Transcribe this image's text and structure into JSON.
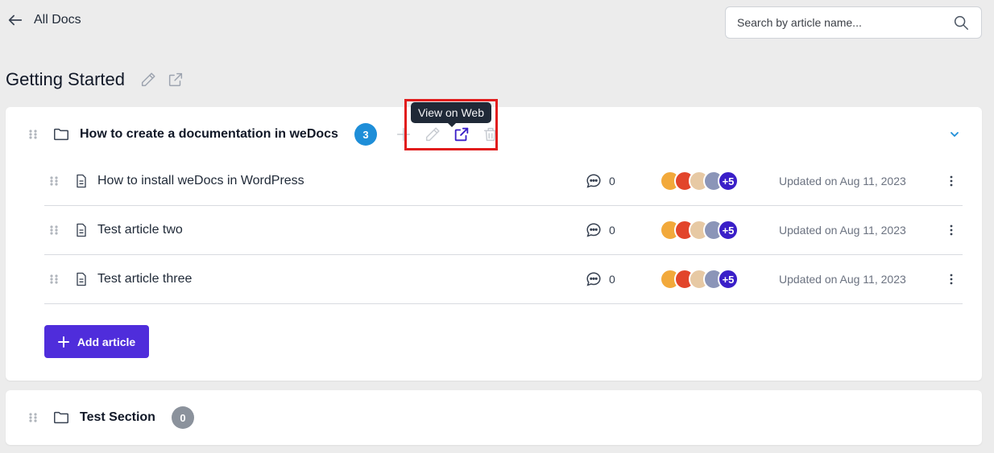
{
  "nav": {
    "back_label": "All Docs"
  },
  "search": {
    "placeholder": "Search by article name..."
  },
  "page": {
    "title": "Getting Started"
  },
  "colors": {
    "accent": "#4f2ddb",
    "badge_blue": "#1e8ed8",
    "badge_gray": "#8b929c",
    "highlight": "#e11d1d",
    "plus_avatar": "#3a1fc8"
  },
  "sections": [
    {
      "title": "How to create a documentation in weDocs",
      "count": "3",
      "tooltip": "View on Web",
      "articles": [
        {
          "title": "How to install weDocs in WordPress",
          "comments": "0",
          "avatar_more": "+5",
          "updated": "Updated on Aug 11, 2023"
        },
        {
          "title": "Test article two",
          "comments": "0",
          "avatar_more": "+5",
          "updated": "Updated on Aug 11, 2023"
        },
        {
          "title": "Test article three",
          "comments": "0",
          "avatar_more": "+5",
          "updated": "Updated on Aug 11, 2023"
        }
      ],
      "add_article_label": "Add article"
    },
    {
      "title": "Test Section",
      "count": "0"
    }
  ]
}
